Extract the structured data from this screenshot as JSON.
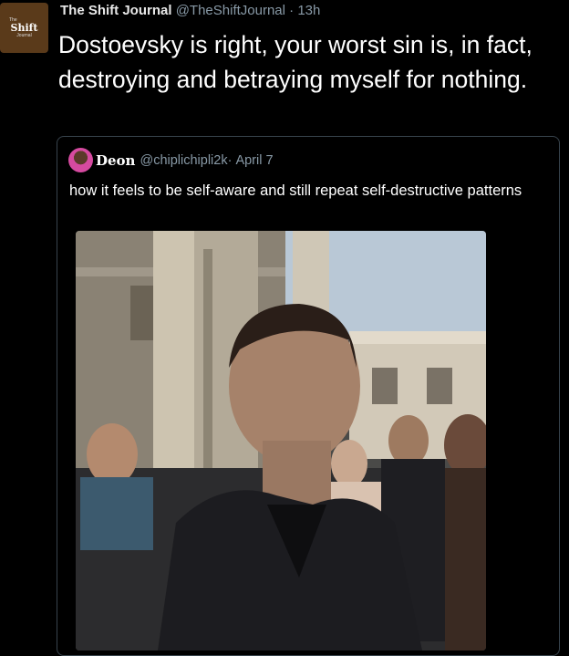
{
  "tweet": {
    "author_logo": "The Shift Journal",
    "author_name": "The Shift Journal",
    "handle": "@TheShiftJournal",
    "separator": "·",
    "time": "13h",
    "text": "Dostoevsky is right, your worst sin is, in fact, destroying and betraying myself for nothing."
  },
  "quoted": {
    "author_name": "Deon",
    "handle": "@chiplichipli2k",
    "separator": "·",
    "date": "April 7",
    "text": "how it feels to be self-aware and still repeat self-destructive patterns"
  },
  "icons": {
    "author_avatar": "shift-journal-logo",
    "quoted_avatar": "user-avatar-icon"
  }
}
